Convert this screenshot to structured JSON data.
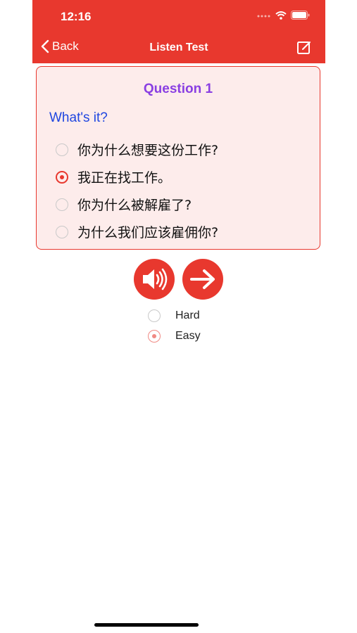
{
  "status_bar": {
    "time": "12:16"
  },
  "nav": {
    "back_label": "Back",
    "title": "Listen Test"
  },
  "question": {
    "title": "Question 1",
    "prompt": "What's it?",
    "options": [
      {
        "text": "你为什么想要这份工作?",
        "selected": false
      },
      {
        "text": "我正在找工作。",
        "selected": true
      },
      {
        "text": "你为什么被解雇了?",
        "selected": false
      },
      {
        "text": "为什么我们应该雇佣你?",
        "selected": false
      }
    ]
  },
  "controls": {
    "play_icon": "speaker-icon",
    "next_icon": "arrow-right-icon"
  },
  "difficulty": {
    "options": [
      {
        "label": "Hard",
        "selected": false
      },
      {
        "label": "Easy",
        "selected": true
      }
    ]
  },
  "colors": {
    "accent": "#e8382e",
    "card_bg": "#fdeceb",
    "title": "#8a3fe2",
    "prompt": "#1f46e0"
  }
}
